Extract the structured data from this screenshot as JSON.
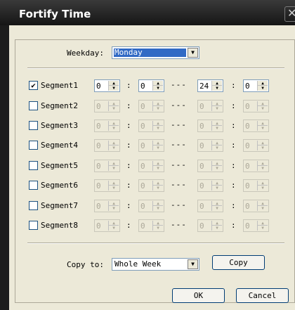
{
  "window": {
    "title": "Fortify Time",
    "close_glyph": "✕"
  },
  "weekday": {
    "label": "Weekday:",
    "value": "Monday"
  },
  "segments": [
    {
      "label": "Segment1",
      "checked": true,
      "start_hour": "0",
      "start_min": "0",
      "end_hour": "24",
      "end_min": "0"
    },
    {
      "label": "Segment2",
      "checked": false,
      "start_hour": "0",
      "start_min": "0",
      "end_hour": "0",
      "end_min": "0"
    },
    {
      "label": "Segment3",
      "checked": false,
      "start_hour": "0",
      "start_min": "0",
      "end_hour": "0",
      "end_min": "0"
    },
    {
      "label": "Segment4",
      "checked": false,
      "start_hour": "0",
      "start_min": "0",
      "end_hour": "0",
      "end_min": "0"
    },
    {
      "label": "Segment5",
      "checked": false,
      "start_hour": "0",
      "start_min": "0",
      "end_hour": "0",
      "end_min": "0"
    },
    {
      "label": "Segment6",
      "checked": false,
      "start_hour": "0",
      "start_min": "0",
      "end_hour": "0",
      "end_min": "0"
    },
    {
      "label": "Segment7",
      "checked": false,
      "start_hour": "0",
      "start_min": "0",
      "end_hour": "0",
      "end_min": "0"
    },
    {
      "label": "Segment8",
      "checked": false,
      "start_hour": "0",
      "start_min": "0",
      "end_hour": "0",
      "end_min": "0"
    }
  ],
  "separators": {
    "colon": ":",
    "dash": "---"
  },
  "copy_to": {
    "label": "Copy to:",
    "value": "Whole Week",
    "button": "Copy"
  },
  "footer": {
    "ok": "OK",
    "cancel": "Cancel"
  },
  "icons": {
    "check": "✔",
    "dropdown": "▼",
    "spin_up": "▲",
    "spin_down": "▼"
  }
}
